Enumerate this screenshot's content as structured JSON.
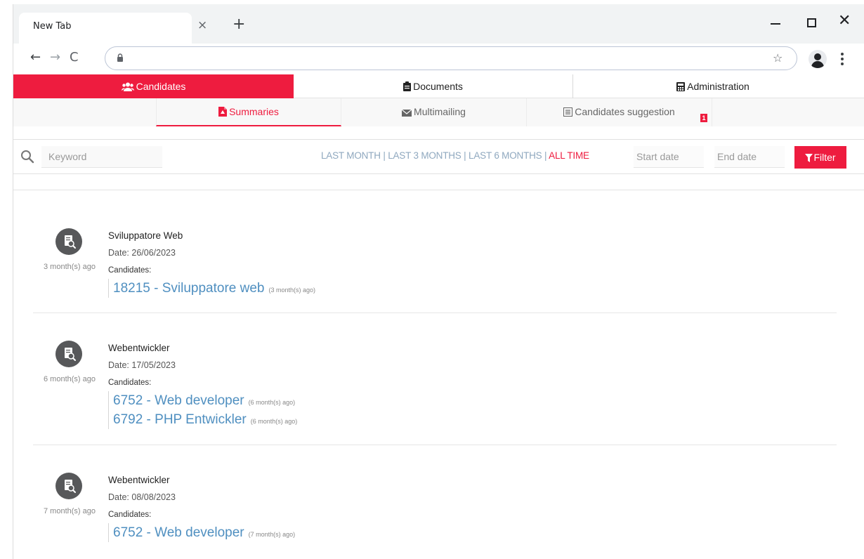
{
  "browser": {
    "tab_title": "New Tab",
    "tab_close": "×",
    "new_tab": "+",
    "close": "✕",
    "back": "←",
    "forward": "→",
    "reload": "C",
    "bookmark": "☆"
  },
  "main_nav": {
    "items": [
      {
        "label": "Candidates",
        "icon": "users-icon",
        "active": true
      },
      {
        "label": "Documents",
        "icon": "clipboard-icon",
        "active": false
      },
      {
        "label": "Administration",
        "icon": "calculator-icon",
        "active": false
      }
    ]
  },
  "sub_nav": {
    "items": [
      {
        "label": "Summaries",
        "icon": "file-pdf-icon",
        "active": true
      },
      {
        "label": "Multimailing",
        "icon": "envelope-icon",
        "active": false
      },
      {
        "label": "Candidates suggestion",
        "icon": "list-icon",
        "active": false
      }
    ],
    "badge": "1"
  },
  "filters": {
    "keyword_placeholder": "Keyword",
    "ranges": [
      "LAST MONTH",
      "LAST 3 MONTHS",
      "LAST 6 MONTHS",
      "ALL TIME"
    ],
    "range_separator": " | ",
    "active_range": "ALL TIME",
    "start_date_placeholder": "Start date",
    "end_date_placeholder": "End date",
    "filter_label": "Filter"
  },
  "summaries": [
    {
      "ago": "3 month(s) ago",
      "title": "Sviluppatore Web",
      "date_label": "Date:",
      "date": "26/06/2023",
      "candidates_label": "Candidates:",
      "candidates": [
        {
          "label": "18215 - Sviluppatore web",
          "ago": "(3 month(s) ago)"
        }
      ]
    },
    {
      "ago": "6 month(s) ago",
      "title": "Webentwickler",
      "date_label": "Date:",
      "date": "17/05/2023",
      "candidates_label": "Candidates:",
      "candidates": [
        {
          "label": "6752 - Web developer",
          "ago": "(6 month(s) ago)"
        },
        {
          "label": "6792 - PHP Entwickler",
          "ago": "(6 month(s) ago)"
        }
      ]
    },
    {
      "ago": "7 month(s) ago",
      "title": "Webentwickler",
      "date_label": "Date:",
      "date": "08/08/2023",
      "candidates_label": "Candidates:",
      "candidates": [
        {
          "label": "6752 - Web developer",
          "ago": "(7 month(s) ago)"
        }
      ]
    }
  ],
  "colors": {
    "accent": "#ee1c3f",
    "link": "#4f8fc0",
    "range_inactive": "#8fa8bf",
    "icon_circle": "#57585a"
  }
}
